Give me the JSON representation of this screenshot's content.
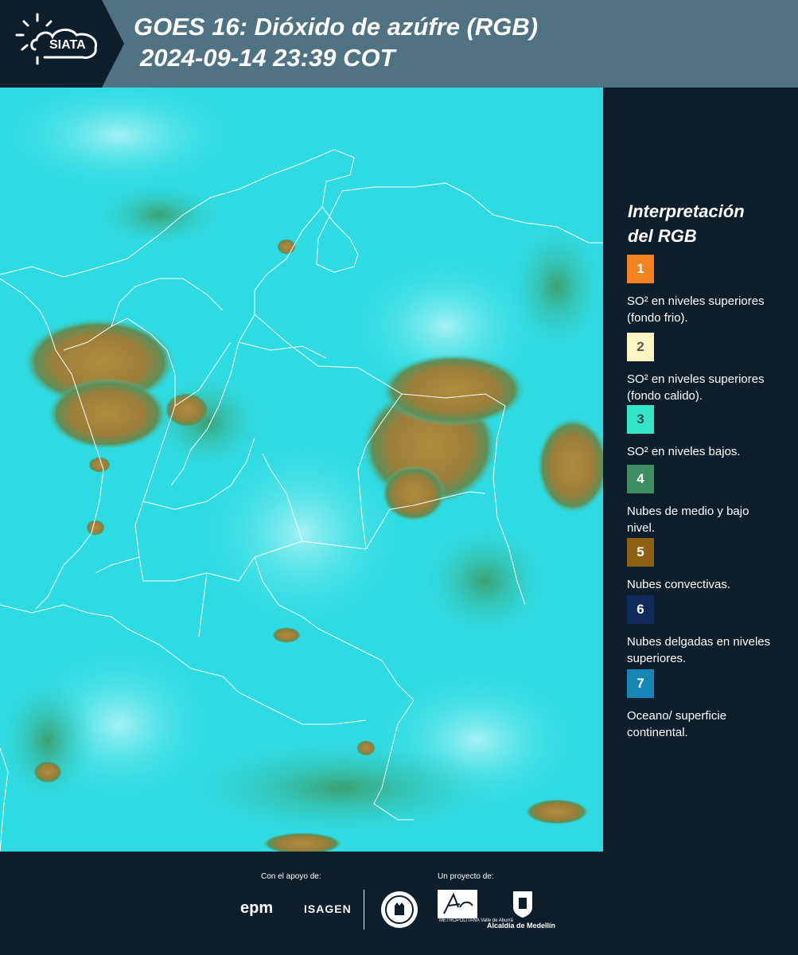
{
  "header": {
    "logo_text": "SIATA",
    "title_line1": "GOES 16: Dióxido de azúfre (RGB)",
    "title_line2": "2024-09-14 23:39 COT"
  },
  "legend": {
    "title_line1": "Interpretación",
    "title_line2": "del RGB",
    "items": [
      {
        "number": "1",
        "text": "SO² en niveles superiores (fondo frio).",
        "color": "#f5821f",
        "num_color": "#ffffff"
      },
      {
        "number": "2",
        "text": "SO² en niveles superiores (fondo calido).",
        "color": "#fdf6c3",
        "num_color": "#5a5a5a"
      },
      {
        "number": "3",
        "text": "SO² en niveles bajos.",
        "color": "#34e6c8",
        "num_color": "#2b4a4a"
      },
      {
        "number": "4",
        "text": "Nubes de medio y bajo nivel.",
        "color": "#3d8e62",
        "num_color": "#ffffff"
      },
      {
        "number": "5",
        "text": "Nubes convectivas.",
        "color": "#8e6014",
        "num_color": "#ffffff"
      },
      {
        "number": "6",
        "text": "Nubes delgadas en niveles superiores.",
        "color": "#112a5c",
        "num_color": "#ffffff"
      },
      {
        "number": "7",
        "text": "Oceano/ superficie continental.",
        "color": "#1586b6",
        "num_color": "#ffffff"
      }
    ]
  },
  "footer": {
    "support_label": "Con el apoyo de:",
    "project_label": "Un proyecto de:",
    "sponsor1": "epm",
    "sponsor2": "ISAGEN",
    "partner_metro": "METROPOLITANA Valle de Aburrá",
    "partner_alcaldia": "Alcaldía de Medellín"
  },
  "map": {
    "background_color": "#2ee0e6",
    "convective_color": "#a0823a",
    "border_color": "#ffffff"
  }
}
